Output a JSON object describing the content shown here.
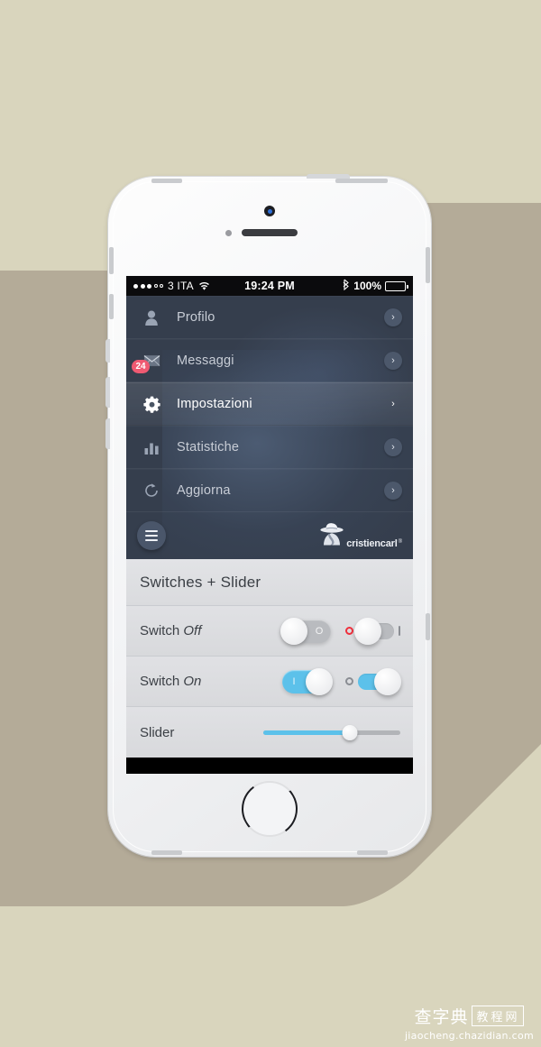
{
  "background": {
    "page_color": "#d9d5bd",
    "shadow_color": "#b4ab98"
  },
  "status_bar": {
    "signal_dots_filled": 3,
    "signal_dots_total": 5,
    "carrier": "3 ITA",
    "wifi_icon": "wifi-icon",
    "time": "19:24 PM",
    "bluetooth_icon": "bluetooth-icon",
    "battery_percent": "100%",
    "battery_icon": "battery-full-icon"
  },
  "menu": {
    "items": [
      {
        "label": "Profilo",
        "icon": "user-icon",
        "chevron": "›",
        "active": false,
        "badge": null
      },
      {
        "label": "Messaggi",
        "icon": "envelope-icon",
        "chevron": "›",
        "active": false,
        "badge": "24"
      },
      {
        "label": "Impostazioni",
        "icon": "gear-icon",
        "chevron": "›",
        "active": true,
        "badge": null
      },
      {
        "label": "Statistiche",
        "icon": "bar-chart-icon",
        "chevron": "›",
        "active": false,
        "badge": null
      },
      {
        "label": "Aggiorna",
        "icon": "refresh-icon",
        "chevron": "›",
        "active": false,
        "badge": null
      }
    ],
    "footer": {
      "hamburger_icon": "hamburger-icon",
      "brand_name": "cristiencarl",
      "brand_reg": "®",
      "brand_logo_icon": "hat-figure-logo-icon"
    },
    "colors": {
      "bg": "#353e4d",
      "active_text": "#ffffff",
      "text": "#c8cdd6",
      "badge": "#ef5a72"
    }
  },
  "panel": {
    "title": "Switches + Slider",
    "rows": [
      {
        "label_prefix": "Switch ",
        "label_emphasis": "Off",
        "switch_a_state": "off",
        "switch_a_glyph": "O",
        "switch_b_state": "off",
        "switch_b_marker_left": "O",
        "switch_b_marker_right": "I"
      },
      {
        "label_prefix": "Switch ",
        "label_emphasis": "On",
        "switch_a_state": "on",
        "switch_a_glyph": "I",
        "switch_b_state": "on",
        "switch_b_marker_left": "O",
        "switch_b_marker_right": "I"
      }
    ],
    "slider": {
      "label": "Slider",
      "value_percent": 63
    },
    "colors": {
      "accent": "#5cc1ea",
      "off_track": "#b9bbbf",
      "red_marker": "#ef2f3c",
      "bg": "#dedfe2"
    }
  },
  "watermark": {
    "cn_text": "查字典",
    "boxed_text": "教程网",
    "url": "jiaocheng.chazidian.com"
  }
}
